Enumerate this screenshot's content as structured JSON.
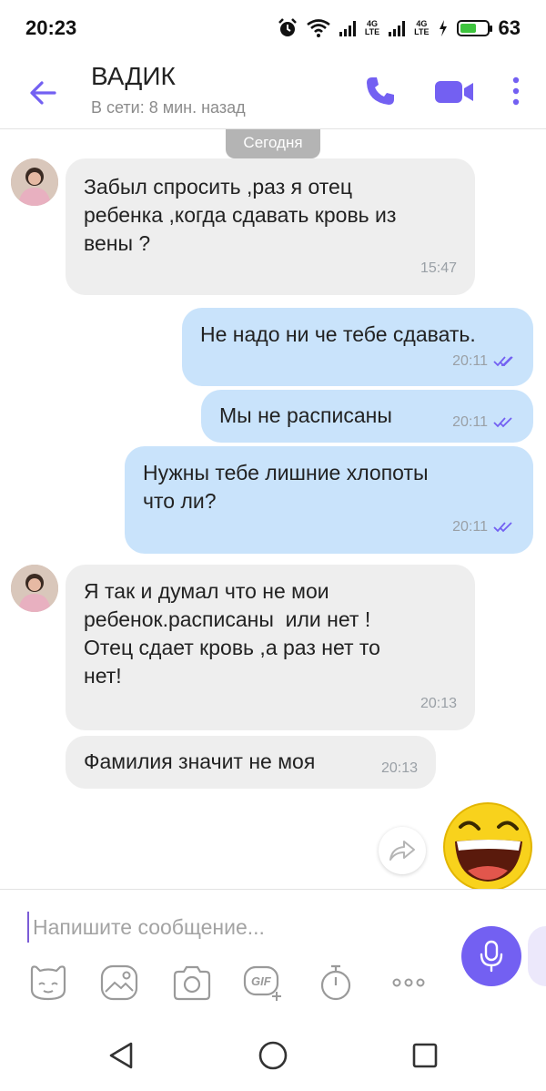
{
  "status_bar": {
    "time": "20:23",
    "net1": "4G",
    "net1_sub": "LTE",
    "net2": "4G",
    "net2_sub": "LTE",
    "battery": "63",
    "battery_level": 0.63
  },
  "header": {
    "name": "ВАДИК",
    "status": "В сети: 8 мин. назад",
    "accent_color": "#7360f2"
  },
  "date_separator": "Сегодня",
  "messages": [
    {
      "dir": "in",
      "text": "Забыл спросить ,раз я отец\nребенка ,когда сдавать кровь из\nвены ?",
      "time": "15:47"
    },
    {
      "dir": "out",
      "text": "Не надо ни че тебе сдавать.",
      "time": "20:11",
      "status": "read"
    },
    {
      "dir": "out",
      "text": "Мы не расписаны",
      "time": "20:11",
      "status": "read"
    },
    {
      "dir": "out",
      "text": "Нужны тебе лишние хлопоты\nчто ли?",
      "time": "20:11",
      "status": "read"
    },
    {
      "dir": "in",
      "text": "Я так и думал что не мои\nребенок.расписаны  или нет !\nОтец сдает кровь ,а раз нет то\nнет!",
      "time": "20:13"
    },
    {
      "dir": "in",
      "text": "Фамилия значит не моя",
      "time": "20:13"
    }
  ],
  "composer": {
    "placeholder": "Напишите сообщение...",
    "value": ""
  },
  "toolbar": {
    "gif_label": "GIF"
  },
  "colors": {
    "incoming_bubble": "#eeeeee",
    "outgoing_bubble": "#c9e3fb",
    "accent": "#7360f2"
  }
}
